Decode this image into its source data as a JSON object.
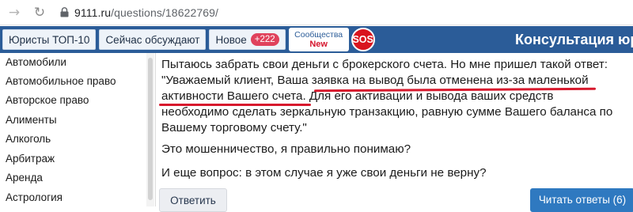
{
  "browser": {
    "url_host": "9111.ru",
    "url_path": "/questions/18622769/",
    "icons": [
      "arrow-left-icon",
      "reload-icon",
      "lock-icon"
    ]
  },
  "nav": {
    "tabs": [
      {
        "label": "Юристы ТОП-10"
      },
      {
        "label": "Сейчас обсуждают"
      },
      {
        "label": "Новое",
        "badge": "+222"
      }
    ],
    "community_line1": "Сообщества",
    "community_line2": "New",
    "sos": "SOS",
    "site_title": "Консультация юр"
  },
  "sidebar": {
    "categories": [
      "Автомобили",
      "Автомобильное право",
      "Авторское право",
      "Алименты",
      "Алкоголь",
      "Арбитраж",
      "Аренда",
      "Астрология"
    ]
  },
  "question": {
    "lines": [
      "Пытаюсь забрать свои деньги с брокерского счета. Но мне пришел такой ответ:",
      "\"Уважаемый клиент, Ваша заявка на вывод была отменена из-за маленькой",
      "активности Вашего счета. Для его активации и вывода ваших средств",
      "необходимо сделать зеркальную транзакцию, равную сумме Вашего баланса по",
      "Вашему торговому счету.\""
    ],
    "paragraph2": "Это мошенничество, я правильно понимаю?",
    "paragraph3": "И еще вопрос: в этом случае я уже свои деньги не верну?"
  },
  "actions": {
    "reply_label": "Ответить",
    "answers_label": "Читать ответы (6)"
  },
  "colors": {
    "nav_background": "#2b5c98",
    "badge": "#e0425c",
    "sos": "#d9141e",
    "underline": "#d7192d",
    "answers_button": "#2f79c0"
  }
}
